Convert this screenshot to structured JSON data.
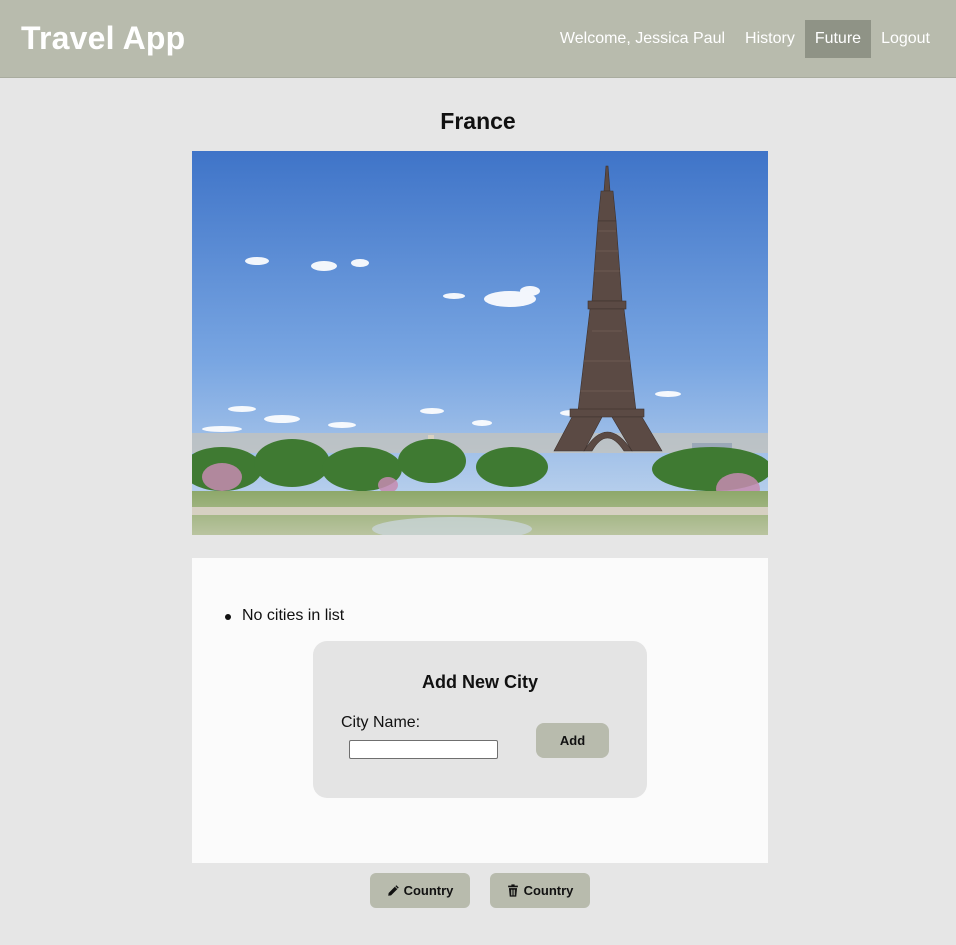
{
  "app": {
    "brand": "Travel App"
  },
  "nav": {
    "welcome": "Welcome, Jessica Paul",
    "items": [
      {
        "label": "History",
        "active": false
      },
      {
        "label": "Future",
        "active": true
      },
      {
        "label": "Logout",
        "active": false
      }
    ]
  },
  "country": {
    "name": "France",
    "photo_icon": "eiffel-tower-photo"
  },
  "cities": {
    "items": [
      "No cities in list"
    ]
  },
  "add_city": {
    "title": "Add New City",
    "field_label": "City Name:",
    "input_value": "",
    "button_label": "Add"
  },
  "actions": {
    "edit": {
      "label": "Country",
      "icon": "pencil-icon"
    },
    "delete": {
      "label": "Country",
      "icon": "trash-icon"
    }
  },
  "colors": {
    "navbar": "#b8bbad",
    "nav_active": "#8f9386",
    "page_bg": "#e6e6e6",
    "panel_bg": "#fbfbfb",
    "card_bg": "#e4e4e4",
    "button_bg": "#b8bbad"
  }
}
